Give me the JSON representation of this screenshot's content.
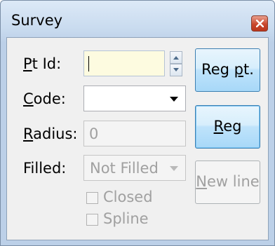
{
  "window": {
    "title": "Survey"
  },
  "form": {
    "pt_id": {
      "label_u": "P",
      "label_rest": "t Id:",
      "value": ""
    },
    "code": {
      "label_u": "C",
      "label_rest": "ode:",
      "value": ""
    },
    "radius": {
      "label_u": "R",
      "label_rest": "adius:",
      "value": "0"
    },
    "filled": {
      "label": "Filled:",
      "value": "Not Filled"
    },
    "closed": {
      "label": "Closed",
      "checked": false
    },
    "spline": {
      "label": "Spline",
      "checked": false
    }
  },
  "buttons": {
    "reg_pt": {
      "label_pre": "Reg ",
      "label_u": "p",
      "label_post": "t."
    },
    "reg": {
      "label_u": "R",
      "label_rest": "eg"
    },
    "new_line": {
      "label_u": "N",
      "label_rest": "ew line"
    }
  },
  "icons": {
    "close": "close-icon",
    "spin_up": "arrow-up-icon",
    "spin_down": "arrow-down-icon",
    "code_dropdown": "chevron-down-icon",
    "filled_dropdown": "chevron-down-icon"
  },
  "colors": {
    "ptid_field_bg": "#fdfbe0",
    "close_button": "#c9472d",
    "button_border": "#3c7fb1"
  }
}
